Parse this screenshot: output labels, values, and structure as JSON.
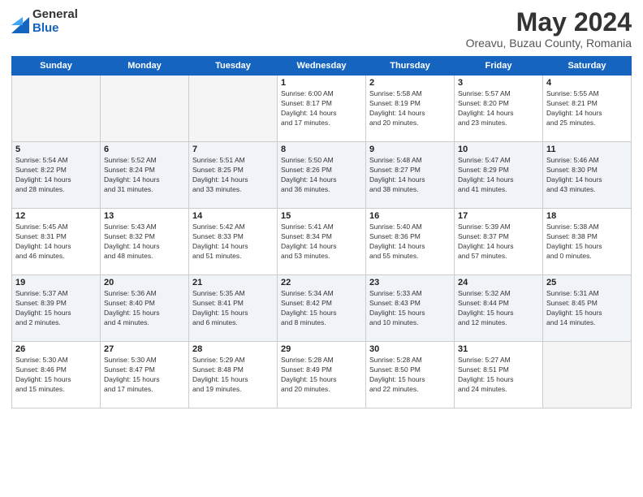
{
  "logo": {
    "general": "General",
    "blue": "Blue"
  },
  "title": {
    "month": "May 2024",
    "location": "Oreavu, Buzau County, Romania"
  },
  "headers": [
    "Sunday",
    "Monday",
    "Tuesday",
    "Wednesday",
    "Thursday",
    "Friday",
    "Saturday"
  ],
  "weeks": [
    [
      {
        "day": "",
        "info": ""
      },
      {
        "day": "",
        "info": ""
      },
      {
        "day": "",
        "info": ""
      },
      {
        "day": "1",
        "info": "Sunrise: 6:00 AM\nSunset: 8:17 PM\nDaylight: 14 hours\nand 17 minutes."
      },
      {
        "day": "2",
        "info": "Sunrise: 5:58 AM\nSunset: 8:19 PM\nDaylight: 14 hours\nand 20 minutes."
      },
      {
        "day": "3",
        "info": "Sunrise: 5:57 AM\nSunset: 8:20 PM\nDaylight: 14 hours\nand 23 minutes."
      },
      {
        "day": "4",
        "info": "Sunrise: 5:55 AM\nSunset: 8:21 PM\nDaylight: 14 hours\nand 25 minutes."
      }
    ],
    [
      {
        "day": "5",
        "info": "Sunrise: 5:54 AM\nSunset: 8:22 PM\nDaylight: 14 hours\nand 28 minutes."
      },
      {
        "day": "6",
        "info": "Sunrise: 5:52 AM\nSunset: 8:24 PM\nDaylight: 14 hours\nand 31 minutes."
      },
      {
        "day": "7",
        "info": "Sunrise: 5:51 AM\nSunset: 8:25 PM\nDaylight: 14 hours\nand 33 minutes."
      },
      {
        "day": "8",
        "info": "Sunrise: 5:50 AM\nSunset: 8:26 PM\nDaylight: 14 hours\nand 36 minutes."
      },
      {
        "day": "9",
        "info": "Sunrise: 5:48 AM\nSunset: 8:27 PM\nDaylight: 14 hours\nand 38 minutes."
      },
      {
        "day": "10",
        "info": "Sunrise: 5:47 AM\nSunset: 8:29 PM\nDaylight: 14 hours\nand 41 minutes."
      },
      {
        "day": "11",
        "info": "Sunrise: 5:46 AM\nSunset: 8:30 PM\nDaylight: 14 hours\nand 43 minutes."
      }
    ],
    [
      {
        "day": "12",
        "info": "Sunrise: 5:45 AM\nSunset: 8:31 PM\nDaylight: 14 hours\nand 46 minutes."
      },
      {
        "day": "13",
        "info": "Sunrise: 5:43 AM\nSunset: 8:32 PM\nDaylight: 14 hours\nand 48 minutes."
      },
      {
        "day": "14",
        "info": "Sunrise: 5:42 AM\nSunset: 8:33 PM\nDaylight: 14 hours\nand 51 minutes."
      },
      {
        "day": "15",
        "info": "Sunrise: 5:41 AM\nSunset: 8:34 PM\nDaylight: 14 hours\nand 53 minutes."
      },
      {
        "day": "16",
        "info": "Sunrise: 5:40 AM\nSunset: 8:36 PM\nDaylight: 14 hours\nand 55 minutes."
      },
      {
        "day": "17",
        "info": "Sunrise: 5:39 AM\nSunset: 8:37 PM\nDaylight: 14 hours\nand 57 minutes."
      },
      {
        "day": "18",
        "info": "Sunrise: 5:38 AM\nSunset: 8:38 PM\nDaylight: 15 hours\nand 0 minutes."
      }
    ],
    [
      {
        "day": "19",
        "info": "Sunrise: 5:37 AM\nSunset: 8:39 PM\nDaylight: 15 hours\nand 2 minutes."
      },
      {
        "day": "20",
        "info": "Sunrise: 5:36 AM\nSunset: 8:40 PM\nDaylight: 15 hours\nand 4 minutes."
      },
      {
        "day": "21",
        "info": "Sunrise: 5:35 AM\nSunset: 8:41 PM\nDaylight: 15 hours\nand 6 minutes."
      },
      {
        "day": "22",
        "info": "Sunrise: 5:34 AM\nSunset: 8:42 PM\nDaylight: 15 hours\nand 8 minutes."
      },
      {
        "day": "23",
        "info": "Sunrise: 5:33 AM\nSunset: 8:43 PM\nDaylight: 15 hours\nand 10 minutes."
      },
      {
        "day": "24",
        "info": "Sunrise: 5:32 AM\nSunset: 8:44 PM\nDaylight: 15 hours\nand 12 minutes."
      },
      {
        "day": "25",
        "info": "Sunrise: 5:31 AM\nSunset: 8:45 PM\nDaylight: 15 hours\nand 14 minutes."
      }
    ],
    [
      {
        "day": "26",
        "info": "Sunrise: 5:30 AM\nSunset: 8:46 PM\nDaylight: 15 hours\nand 15 minutes."
      },
      {
        "day": "27",
        "info": "Sunrise: 5:30 AM\nSunset: 8:47 PM\nDaylight: 15 hours\nand 17 minutes."
      },
      {
        "day": "28",
        "info": "Sunrise: 5:29 AM\nSunset: 8:48 PM\nDaylight: 15 hours\nand 19 minutes."
      },
      {
        "day": "29",
        "info": "Sunrise: 5:28 AM\nSunset: 8:49 PM\nDaylight: 15 hours\nand 20 minutes."
      },
      {
        "day": "30",
        "info": "Sunrise: 5:28 AM\nSunset: 8:50 PM\nDaylight: 15 hours\nand 22 minutes."
      },
      {
        "day": "31",
        "info": "Sunrise: 5:27 AM\nSunset: 8:51 PM\nDaylight: 15 hours\nand 24 minutes."
      },
      {
        "day": "",
        "info": ""
      }
    ]
  ]
}
